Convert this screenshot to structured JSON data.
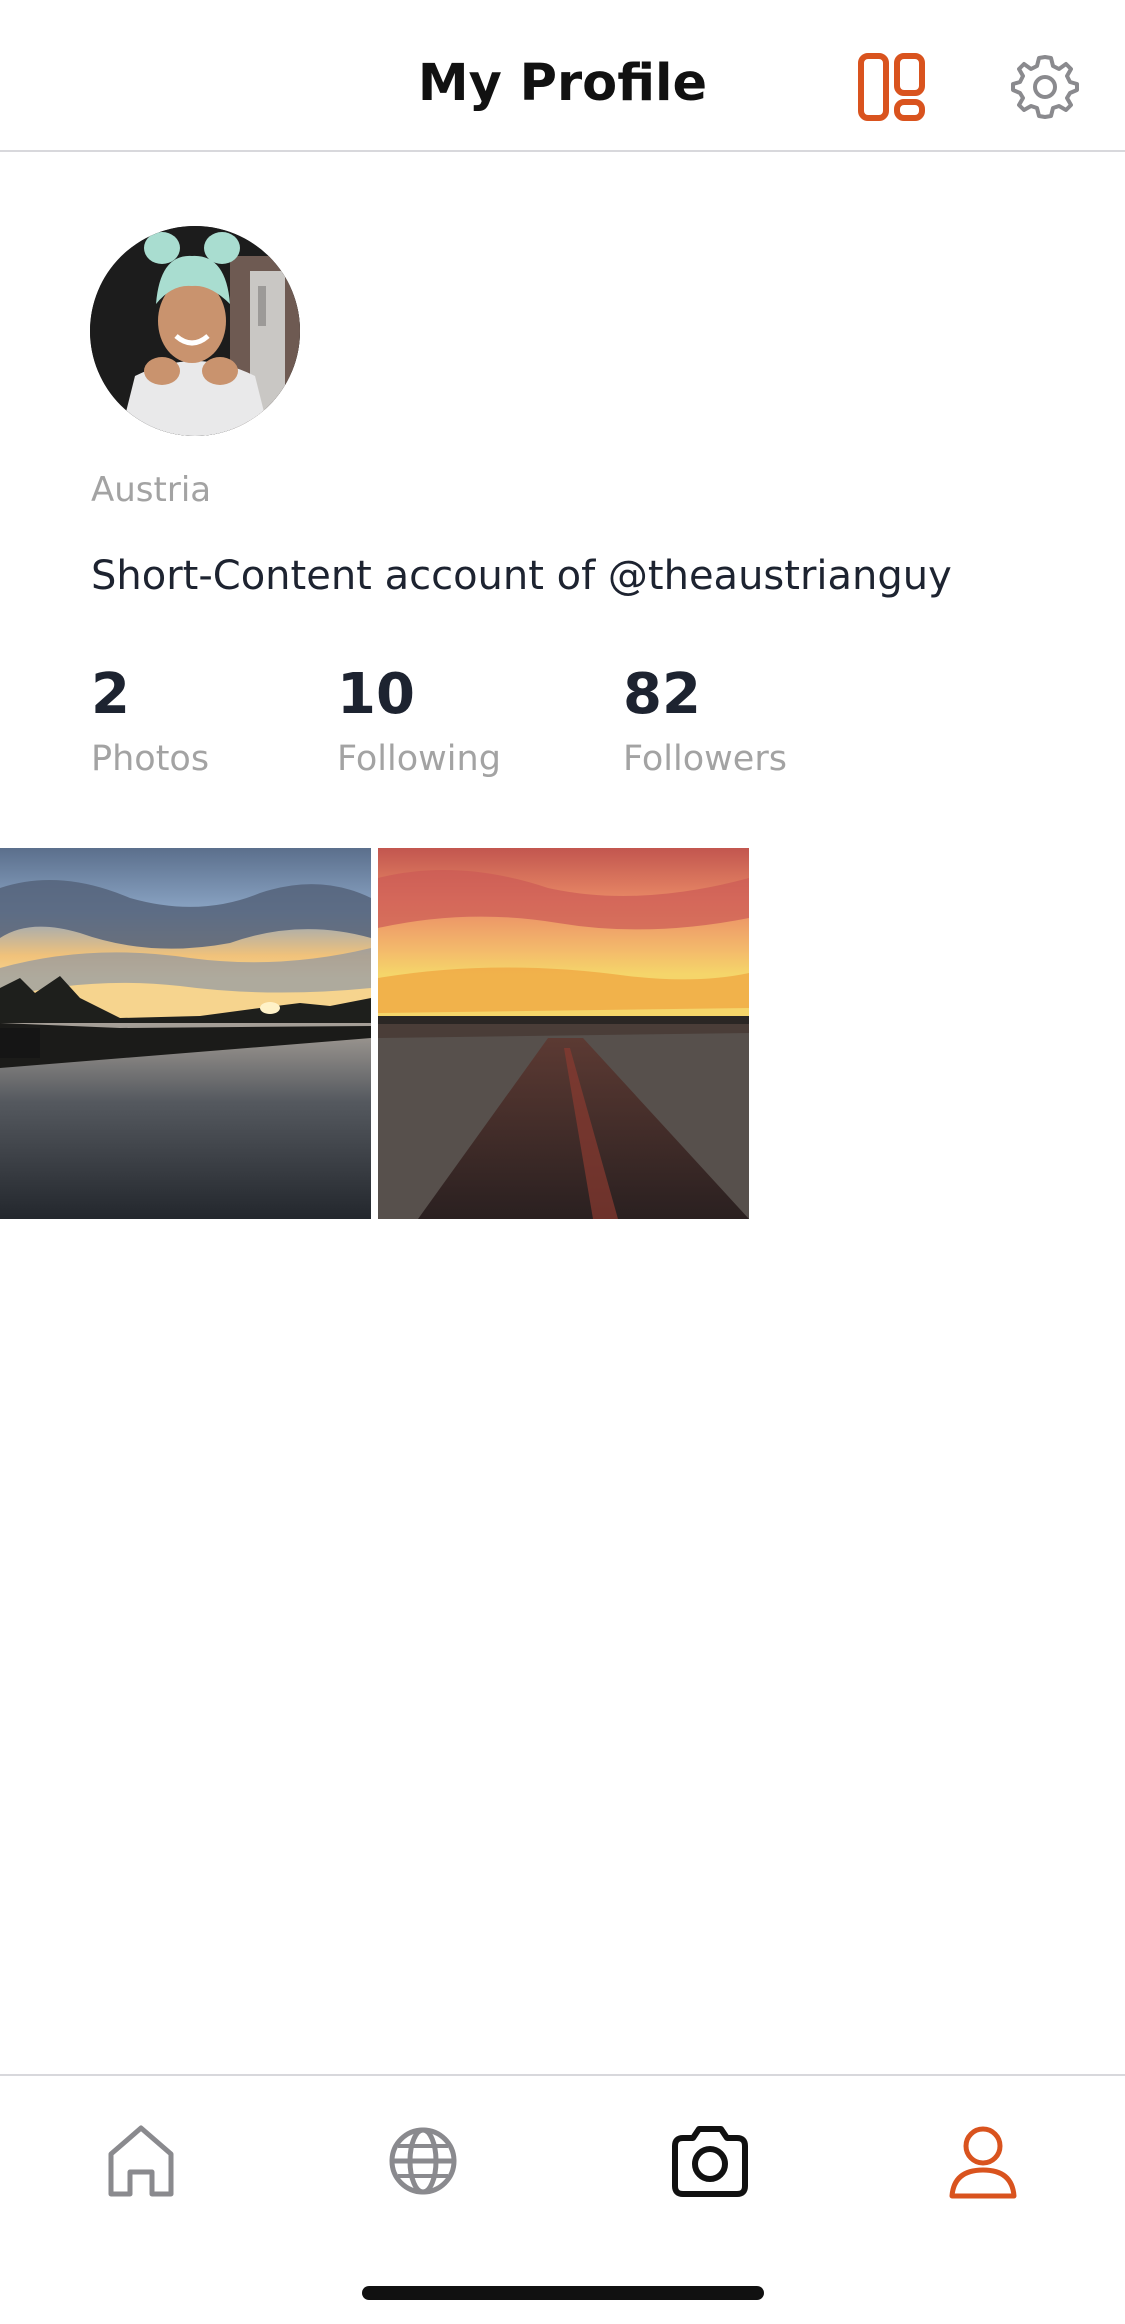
{
  "header": {
    "title": "My Profile",
    "layout_icon": "layout-grid-icon",
    "settings_icon": "gear-icon"
  },
  "profile": {
    "location": "Austria",
    "bio": "Short-Content account of @theaustrianguy",
    "stats": [
      {
        "value": "2",
        "label": "Photos"
      },
      {
        "value": "10",
        "label": "Following"
      },
      {
        "value": "82",
        "label": "Followers"
      }
    ]
  },
  "photos": [
    {
      "subject": "river-sunset"
    },
    {
      "subject": "road-sunset"
    }
  ],
  "tabbar": {
    "items": [
      {
        "icon": "home-icon"
      },
      {
        "icon": "globe-icon"
      },
      {
        "icon": "camera-icon"
      },
      {
        "icon": "user-icon",
        "active": true
      }
    ]
  },
  "colors": {
    "accent": "#d9531e",
    "icon_gray": "#8a8a8e",
    "text_dark": "#1d2330",
    "text_muted": "#a3a3a3",
    "divider": "#d8d8dc"
  }
}
